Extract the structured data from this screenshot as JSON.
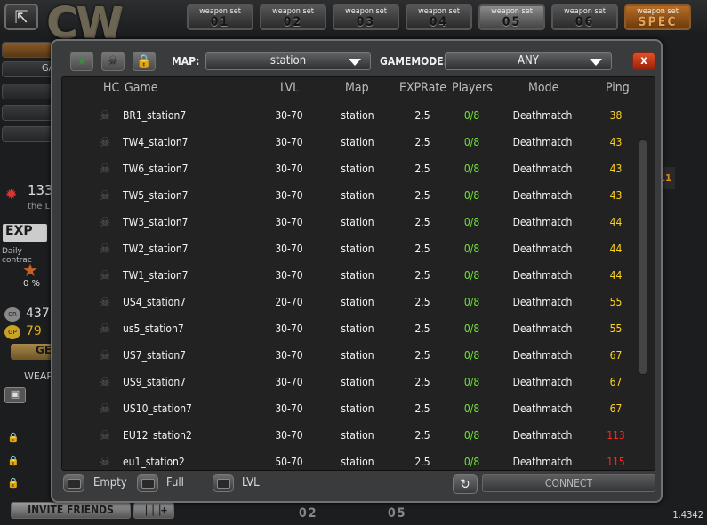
{
  "top": {
    "exit_icon": "exit-icon",
    "logo": "CW",
    "weapon_sets": [
      {
        "title": "weapon set",
        "number": "01"
      },
      {
        "title": "weapon set",
        "number": "02"
      },
      {
        "title": "weapon set",
        "number": "03"
      },
      {
        "title": "weapon set",
        "number": "04"
      },
      {
        "title": "weapon set",
        "number": "05"
      },
      {
        "title": "weapon set",
        "number": "06"
      },
      {
        "title": "weapon set",
        "number": "SPEC"
      }
    ]
  },
  "left": {
    "ga_label": "GA",
    "stat1": "133",
    "the_l": "the L",
    "exp": "EXP",
    "daily": "Daily contrac",
    "percent": "0 %",
    "cr": "437",
    "gp": "79",
    "ge": "GE",
    "weap": "WEAPO"
  },
  "right": {
    "badge": "11"
  },
  "bottom": {
    "invite": "INVITE FRIENDS",
    "invite_plus": "+",
    "num1": "02",
    "num2": "05",
    "version": "1.4342"
  },
  "filters": {
    "map_label": "MAP:",
    "map_value": "station",
    "mode_label": "GAMEMODE:",
    "mode_value": "ANY",
    "close": "x"
  },
  "columns": {
    "hc": "HC",
    "game": "Game",
    "lvl": "LVL",
    "map": "Map",
    "exprate": "EXPRate",
    "players": "Players",
    "mode": "Mode",
    "ping": "Ping"
  },
  "servers": [
    {
      "game": "BR1_station7",
      "lvl": "30-70",
      "map": "station",
      "exp": "2.5",
      "players": "0/8",
      "mode": "Deathmatch",
      "ping": "38"
    },
    {
      "game": "TW4_station7",
      "lvl": "30-70",
      "map": "station",
      "exp": "2.5",
      "players": "0/8",
      "mode": "Deathmatch",
      "ping": "43"
    },
    {
      "game": "TW6_station7",
      "lvl": "30-70",
      "map": "station",
      "exp": "2.5",
      "players": "0/8",
      "mode": "Deathmatch",
      "ping": "43"
    },
    {
      "game": "TW5_station7",
      "lvl": "30-70",
      "map": "station",
      "exp": "2.5",
      "players": "0/8",
      "mode": "Deathmatch",
      "ping": "43"
    },
    {
      "game": "TW3_station7",
      "lvl": "30-70",
      "map": "station",
      "exp": "2.5",
      "players": "0/8",
      "mode": "Deathmatch",
      "ping": "44"
    },
    {
      "game": "TW2_station7",
      "lvl": "30-70",
      "map": "station",
      "exp": "2.5",
      "players": "0/8",
      "mode": "Deathmatch",
      "ping": "44"
    },
    {
      "game": "TW1_station7",
      "lvl": "30-70",
      "map": "station",
      "exp": "2.5",
      "players": "0/8",
      "mode": "Deathmatch",
      "ping": "44"
    },
    {
      "game": "US4_station7",
      "lvl": "20-70",
      "map": "station",
      "exp": "2.5",
      "players": "0/8",
      "mode": "Deathmatch",
      "ping": "55"
    },
    {
      "game": "us5_station7",
      "lvl": "30-70",
      "map": "station",
      "exp": "2.5",
      "players": "0/8",
      "mode": "Deathmatch",
      "ping": "55"
    },
    {
      "game": "US7_station7",
      "lvl": "30-70",
      "map": "station",
      "exp": "2.5",
      "players": "0/8",
      "mode": "Deathmatch",
      "ping": "67"
    },
    {
      "game": "US9_station7",
      "lvl": "30-70",
      "map": "station",
      "exp": "2.5",
      "players": "0/8",
      "mode": "Deathmatch",
      "ping": "67"
    },
    {
      "game": "US10_station7",
      "lvl": "30-70",
      "map": "station",
      "exp": "2.5",
      "players": "0/8",
      "mode": "Deathmatch",
      "ping": "67"
    },
    {
      "game": "EU12_station2",
      "lvl": "30-70",
      "map": "station",
      "exp": "2.5",
      "players": "0/8",
      "mode": "Deathmatch",
      "ping": "113"
    },
    {
      "game": "eu1_station2",
      "lvl": "50-70",
      "map": "station",
      "exp": "2.5",
      "players": "0/8",
      "mode": "Deathmatch",
      "ping": "115"
    }
  ],
  "ping_colors": {
    "low": "#ffd21e",
    "high": "#ff2a1a"
  },
  "controls": {
    "empty": "Empty",
    "full": "Full",
    "lvl": "LVL",
    "connect": "CONNECT"
  }
}
